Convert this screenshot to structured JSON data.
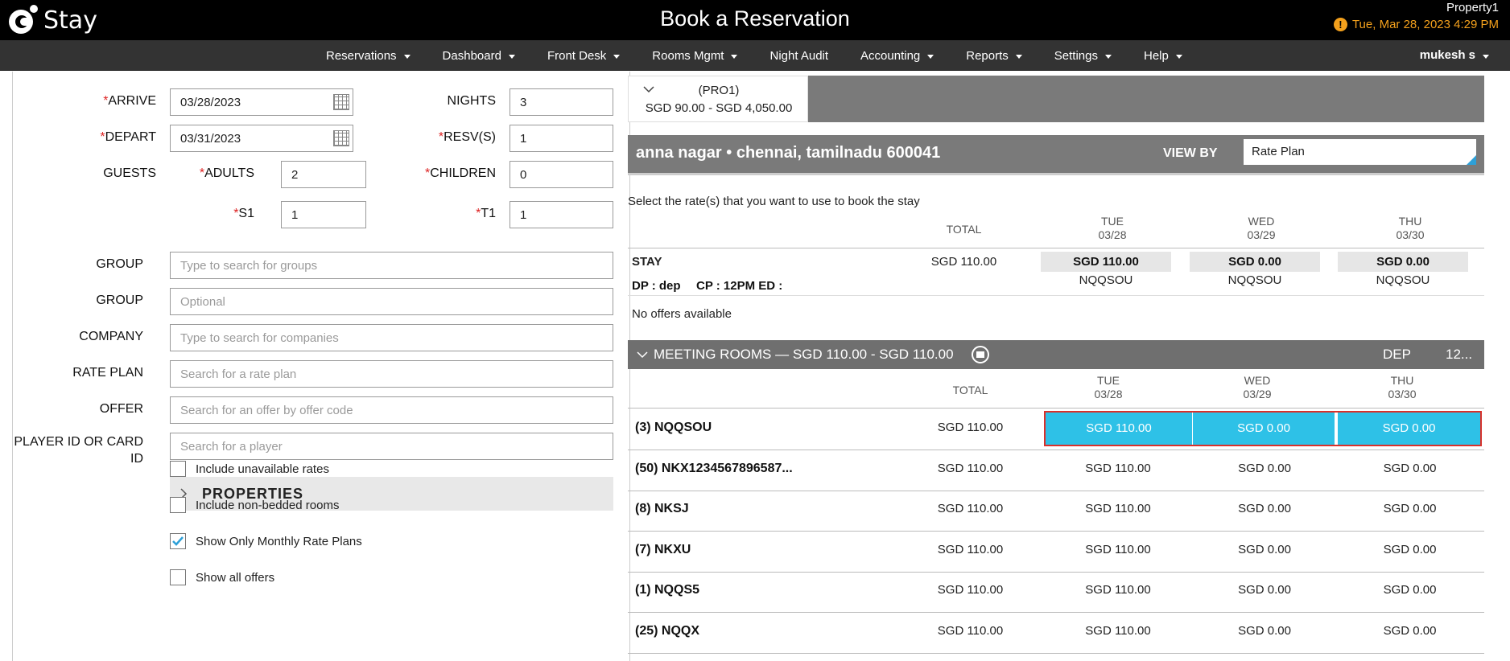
{
  "header": {
    "logo_text": "Stay",
    "title": "Book a Reservation",
    "property": "Property1",
    "datetime": "Tue, Mar 28, 2023 4:29 PM",
    "warning_icon": "warning-icon",
    "warning_color": "#f3a01c"
  },
  "nav": {
    "items": [
      {
        "label": "Reservations",
        "dropdown": true
      },
      {
        "label": "Dashboard",
        "dropdown": true
      },
      {
        "label": "Front Desk",
        "dropdown": true
      },
      {
        "label": "Rooms Mgmt",
        "dropdown": true
      },
      {
        "label": "Night Audit",
        "dropdown": false
      },
      {
        "label": "Accounting",
        "dropdown": true
      },
      {
        "label": "Reports",
        "dropdown": true
      },
      {
        "label": "Settings",
        "dropdown": true
      },
      {
        "label": "Help",
        "dropdown": true
      }
    ],
    "user": "mukesh s"
  },
  "form": {
    "arrive_label": "ARRIVE",
    "arrive_value": "03/28/2023",
    "depart_label": "DEPART",
    "depart_value": "03/31/2023",
    "nights_label": "NIGHTS",
    "nights_value": "3",
    "resvs_label": "RESV(S)",
    "resvs_value": "1",
    "guests_label": "GUESTS",
    "adults_label": "ADULTS",
    "adults_value": "2",
    "children_label": "CHILDREN",
    "children_value": "0",
    "s1_label": "S1",
    "s1_value": "1",
    "t1_label": "T1",
    "t1_value": "1",
    "required_mark": "*",
    "group1_label": "GROUP",
    "group1_placeholder": "Type to search for groups",
    "group2_label": "GROUP",
    "group2_placeholder": "Optional",
    "company_label": "COMPANY",
    "company_placeholder": "Type to search for companies",
    "rate_plan_label": "RATE PLAN",
    "rate_plan_placeholder": "Search for a rate plan",
    "offer_label": "OFFER",
    "offer_placeholder": "Search for an offer by offer code",
    "player_label": "PLAYER ID OR CARD ID",
    "player_placeholder": "Search for a player",
    "properties_title": "PROPERTIES",
    "checkboxes": [
      {
        "label": "Include unavailable rates",
        "checked": false
      },
      {
        "label": "Include non-bedded rooms",
        "checked": false
      },
      {
        "label": "Show Only Monthly Rate Plans",
        "checked": true
      },
      {
        "label": "Show all offers",
        "checked": false
      }
    ],
    "check_color": "#2ea0d8"
  },
  "property_tab": {
    "code": "(PRO1)",
    "range": "SGD 90.00 - SGD 4,050.00"
  },
  "location": {
    "address": "anna nagar • chennai, tamilnadu 600041",
    "view_by_label": "VIEW BY",
    "view_by_value": "Rate Plan"
  },
  "hint": "Select the rate(s) that you want to use to book the stay",
  "columns": {
    "total": "TOTAL",
    "days": [
      {
        "day": "TUE",
        "date": "03/28"
      },
      {
        "day": "WED",
        "date": "03/29"
      },
      {
        "day": "THU",
        "date": "03/30"
      }
    ]
  },
  "stay": {
    "label": "STAY",
    "total": "SGD 110.00",
    "day_values": [
      "SGD 110.00",
      "SGD 0.00",
      "SGD 0.00"
    ],
    "day_codes": [
      "NQQSOU",
      "NQQSOU",
      "NQQSOU"
    ],
    "dp": "DP : dep",
    "cp": "CP : 12PM ED :",
    "no_offers": "No offers available"
  },
  "meeting_rooms": {
    "title": "MEETING ROOMS — SGD 110.00 - SGD 110.00",
    "dep": "DEP",
    "time": "12...",
    "rows": [
      {
        "label": "(3) NQQSOU",
        "total": "SGD 110.00",
        "days": [
          "SGD 110.00",
          "SGD 0.00",
          "SGD 0.00"
        ],
        "selected": true
      },
      {
        "label": "(50) NKX1234567896587...",
        "total": "SGD 110.00",
        "days": [
          "SGD 110.00",
          "SGD 0.00",
          "SGD 0.00"
        ],
        "selected": false
      },
      {
        "label": "(8) NKSJ",
        "total": "SGD 110.00",
        "days": [
          "SGD 110.00",
          "SGD 0.00",
          "SGD 0.00"
        ],
        "selected": false
      },
      {
        "label": "(7) NKXU",
        "total": "SGD 110.00",
        "days": [
          "SGD 110.00",
          "SGD 0.00",
          "SGD 0.00"
        ],
        "selected": false
      },
      {
        "label": "(1) NQQS5",
        "total": "SGD 110.00",
        "days": [
          "SGD 110.00",
          "SGD 0.00",
          "SGD 0.00"
        ],
        "selected": false
      },
      {
        "label": "(25) NQQX",
        "total": "SGD 110.00",
        "days": [
          "SGD 110.00",
          "SGD 0.00",
          "SGD 0.00"
        ],
        "selected": false
      }
    ],
    "selected_color": "#2ec1e7",
    "outline_color": "#d9312b"
  }
}
